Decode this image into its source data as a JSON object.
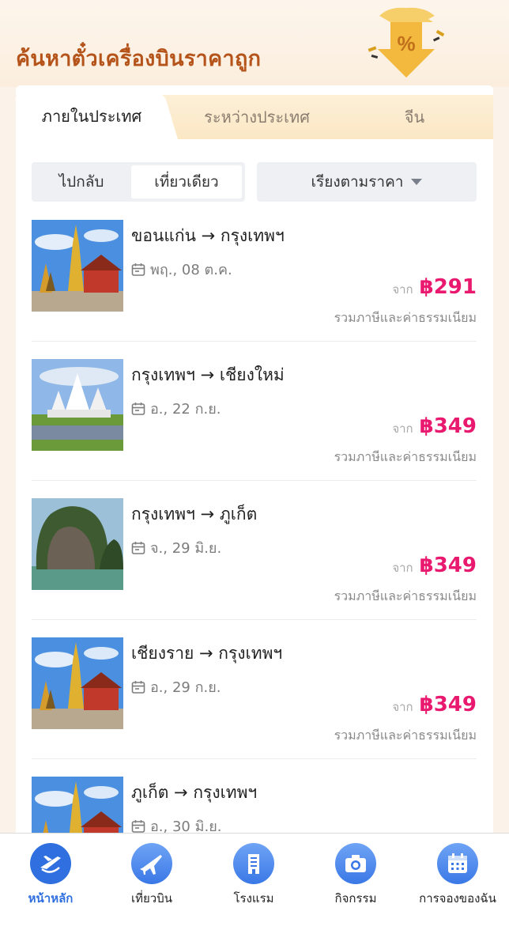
{
  "header": {
    "title": "ค้นหาตั๋วเครื่องบินราคาถูก",
    "promo_symbol": "%"
  },
  "tabs": [
    {
      "label": "ภายในประเทศ",
      "active": true
    },
    {
      "label": "ระหว่างประเทศ",
      "active": false
    },
    {
      "label": "จีน",
      "active": false
    }
  ],
  "trip_toggle": {
    "options": [
      {
        "label": "ไปกลับ",
        "active": false
      },
      {
        "label": "เที่ยวเดียว",
        "active": true
      }
    ]
  },
  "sort": {
    "label": "เรียงตามราคา"
  },
  "flights": [
    {
      "route": "ขอนแก่น → กรุงเทพฯ",
      "date": "พฤ., 08 ต.ค.",
      "from_label": "จาก",
      "price": "฿291",
      "fee_note": "รวมภาษีและค่าธรรมเนียม",
      "image": "temple-image"
    },
    {
      "route": "กรุงเทพฯ → เชียงใหม่",
      "date": "อ., 22 ก.ย.",
      "from_label": "จาก",
      "price": "฿349",
      "fee_note": "รวมภาษีและค่าธรรมเนียม",
      "image": "white-temple-image"
    },
    {
      "route": "กรุงเทพฯ → ภูเก็ต",
      "date": "จ., 29 มิ.ย.",
      "from_label": "จาก",
      "price": "฿349",
      "fee_note": "รวมภาษีและค่าธรรมเนียม",
      "image": "island-cliff-image"
    },
    {
      "route": "เชียงราย → กรุงเทพฯ",
      "date": "อ., 29 ก.ย.",
      "from_label": "จาก",
      "price": "฿349",
      "fee_note": "รวมภาษีและค่าธรรมเนียม",
      "image": "temple-image"
    },
    {
      "route": "ภูเก็ต → กรุงเทพฯ",
      "date": "อ., 30 มิ.ย.",
      "from_label": "จาก",
      "price": "",
      "fee_note": "",
      "image": "temple-image"
    }
  ],
  "bottom_nav": [
    {
      "label": "หน้าหลัก",
      "icon": "home-icon",
      "active": true
    },
    {
      "label": "เที่ยวบิน",
      "icon": "airplane-icon",
      "active": false
    },
    {
      "label": "โรงแรม",
      "icon": "hotel-icon",
      "active": false
    },
    {
      "label": "กิจกรรม",
      "icon": "camera-icon",
      "active": false
    },
    {
      "label": "การจองของฉัน",
      "icon": "calendar-icon",
      "active": false
    }
  ],
  "colors": {
    "accent_orange": "#b5541a",
    "price_pink": "#e8196e",
    "nav_blue": "#2f6fe0"
  }
}
